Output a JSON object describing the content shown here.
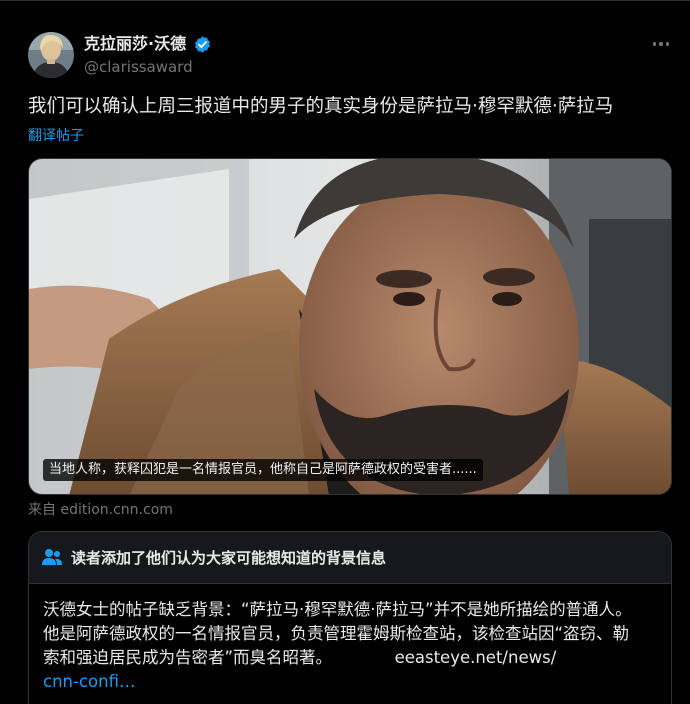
{
  "author": {
    "display_name": "克拉丽莎·沃德",
    "handle": "@clarissaward",
    "verified": true
  },
  "tweet": {
    "text": "我们可以确认上周三报道中的男子的真实身份是萨拉马·穆罕默德·萨拉马",
    "translate_label": "翻译帖子"
  },
  "media": {
    "caption": "当地人称，获释囚犯是一名情报官员，他称自己是阿萨德政权的受害者......"
  },
  "source": {
    "label": "来自 edition.cnn.com"
  },
  "community_note": {
    "title": "读者添加了他们认为大家可能想知道的背景信息",
    "body_line1": "沃德女士的帖子缺乏背景：“萨拉马·穆罕默德·萨拉马”并不是她所描绘的普通人。",
    "body_line2": "他是阿萨德政权的一名情报官员，负责管理霍姆斯检查站，该检查站因“盗窃、勒",
    "body_line3_text": "索和强迫居民成为告密者”而臭名昭著。",
    "body_line3_link": "eeasteye.net/news/",
    "body_line4_link": "cnn-confi…"
  },
  "colors": {
    "background": "#000000",
    "text_primary": "#e7e9ea",
    "text_secondary": "#71767b",
    "accent": "#1d9bf0",
    "border": "#2f3336"
  },
  "icons": {
    "verified": "verified-badge-icon",
    "more": "more-icon",
    "note": "people-icon"
  }
}
